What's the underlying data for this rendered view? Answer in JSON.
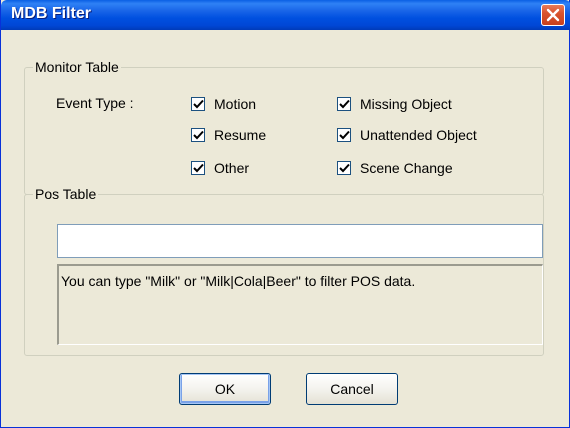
{
  "window": {
    "title": "MDB Filter"
  },
  "monitor_table": {
    "legend": "Monitor Table",
    "event_type_label": "Event Type :",
    "checkboxes": [
      {
        "label": "Motion",
        "checked": true
      },
      {
        "label": "Resume",
        "checked": true
      },
      {
        "label": "Other",
        "checked": true
      },
      {
        "label": "Missing Object",
        "checked": true
      },
      {
        "label": "Unattended Object",
        "checked": true
      },
      {
        "label": "Scene Change",
        "checked": true
      }
    ]
  },
  "pos_table": {
    "legend": "Pos Table",
    "filter_value": "",
    "hint": "You can type \"Milk\" or \"Milk|Cola|Beer\" to filter POS data."
  },
  "buttons": {
    "ok": "OK",
    "cancel": "Cancel"
  },
  "icons": {
    "close": "close-icon",
    "check": "check-icon"
  },
  "colors": {
    "titlebar": "#0050e0",
    "dialog_bg": "#ece9d8",
    "close_button": "#d9542f"
  }
}
